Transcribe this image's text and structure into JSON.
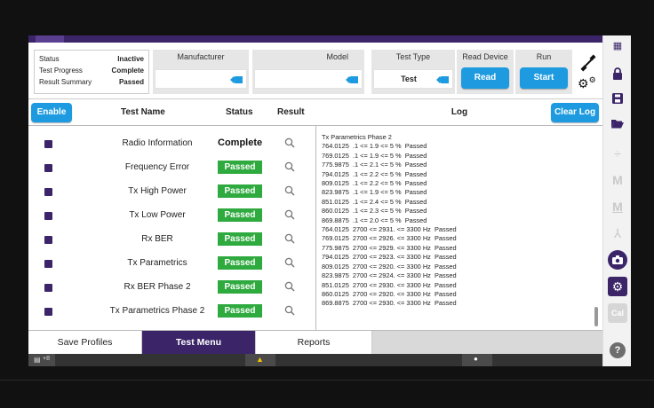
{
  "status_box": {
    "rows": [
      {
        "label": "Status",
        "value": "Inactive"
      },
      {
        "label": "Test Progress",
        "value": "Complete"
      },
      {
        "label": "Result Summary",
        "value": "Passed"
      }
    ]
  },
  "header": {
    "manufacturer_label": "Manufacturer",
    "manufacturer_value": "",
    "model_label": "Model",
    "model_value": "",
    "test_type_label": "Test Type",
    "test_type_value": "Test",
    "read_device_label": "Read Device",
    "read_button": "Read",
    "run_label": "Run",
    "start_button": "Start"
  },
  "tests_panel": {
    "enable_button": "Enable",
    "col_name": "Test Name",
    "col_status": "Status",
    "col_result": "Result",
    "rows": [
      {
        "name": "Radio Information",
        "status": "Complete",
        "status_style": "plain"
      },
      {
        "name": "Frequency Error",
        "status": "Passed",
        "status_style": "passed"
      },
      {
        "name": "Tx High Power",
        "status": "Passed",
        "status_style": "passed"
      },
      {
        "name": "Tx Low Power",
        "status": "Passed",
        "status_style": "passed"
      },
      {
        "name": "Rx BER",
        "status": "Passed",
        "status_style": "passed"
      },
      {
        "name": "Tx Parametrics",
        "status": "Passed",
        "status_style": "passed"
      },
      {
        "name": "Rx BER Phase 2",
        "status": "Passed",
        "status_style": "passed"
      },
      {
        "name": "Tx Parametrics Phase 2",
        "status": "Passed",
        "status_style": "passed"
      }
    ]
  },
  "log_panel": {
    "title": "Log",
    "clear_button": "Clear Log",
    "lines": [
      "Tx Parametrics Phase 2",
      "764.0125  .1 <= 1.9 <= 5 %  Passed",
      "769.0125  .1 <= 1.9 <= 5 %  Passed",
      "775.9875  .1 <= 2.1 <= 5 %  Passed",
      "794.0125  .1 <= 2.2 <= 5 %  Passed",
      "809.0125  .1 <= 2.2 <= 5 %  Passed",
      "823.9875  .1 <= 1.9 <= 5 %  Passed",
      "851.0125  .1 <= 2.4 <= 5 %  Passed",
      "860.0125  .1 <= 2.3 <= 5 %  Passed",
      "869.8875  .1 <= 2.0 <= 5 %  Passed",
      "764.0125  2700 <= 2931. <= 3300 Hz  Passed",
      "769.0125  2700 <= 2926. <= 3300 Hz  Passed",
      "775.9875  2700 <= 2929. <= 3300 Hz  Passed",
      "794.0125  2700 <= 2923. <= 3300 Hz  Passed",
      "809.0125  2700 <= 2920. <= 3300 Hz  Passed",
      "823.9875  2700 <= 2924. <= 3300 Hz  Passed",
      "851.0125  2700 <= 2930. <= 3300 Hz  Passed",
      "860.0125  2700 <= 2920. <= 3300 Hz  Passed",
      "869.8875  2700 <= 2930. <= 3300 Hz  Passed"
    ]
  },
  "tabs": [
    {
      "label": "Save Profiles",
      "active": false
    },
    {
      "label": "Test Menu",
      "active": true
    },
    {
      "label": "Reports",
      "active": false
    }
  ],
  "statusbar": {
    "left_text": "+8"
  },
  "sidebar": {
    "cal_label": "Cal",
    "help_label": "?"
  },
  "colors": {
    "accent": "#3b2568",
    "button_blue": "#1e9be0",
    "passed_green": "#2faa3f"
  }
}
